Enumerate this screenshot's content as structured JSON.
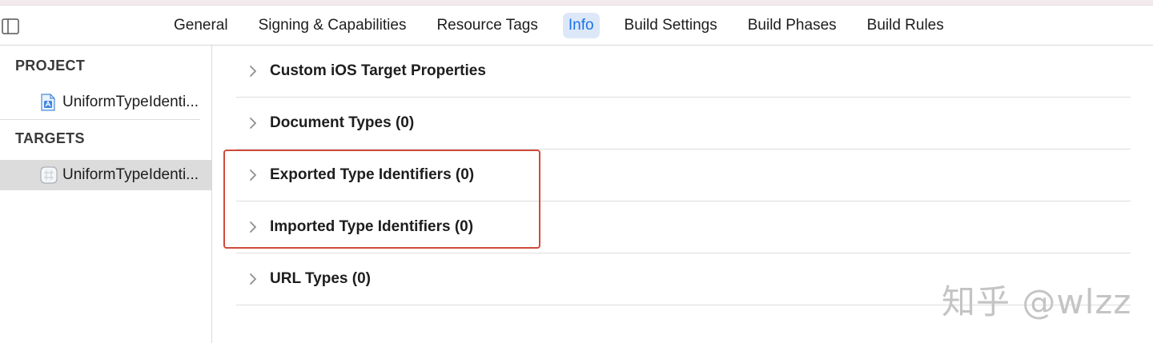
{
  "tabs": [
    {
      "label": "General",
      "active": false
    },
    {
      "label": "Signing & Capabilities",
      "active": false
    },
    {
      "label": "Resource Tags",
      "active": false
    },
    {
      "label": "Info",
      "active": true
    },
    {
      "label": "Build Settings",
      "active": false
    },
    {
      "label": "Build Phases",
      "active": false
    },
    {
      "label": "Build Rules",
      "active": false
    }
  ],
  "sidebar": {
    "project_header": "PROJECT",
    "project_item": {
      "label": "UniformTypeIdenti...",
      "icon": "xcode-project-icon"
    },
    "targets_header": "TARGETS",
    "target_item": {
      "label": "UniformTypeIdenti...",
      "icon": "app-target-icon",
      "selected": true
    }
  },
  "sections": [
    {
      "title": "Custom iOS Target Properties"
    },
    {
      "title": "Document Types (0)"
    },
    {
      "title": "Exported Type Identifiers (0)"
    },
    {
      "title": "Imported Type Identifiers (0)"
    },
    {
      "title": "URL Types (0)"
    }
  ],
  "watermark": "知乎 @wlzz",
  "colors": {
    "accent": "#1a73e8",
    "active_tab_bg": "#dce8f8",
    "highlight_border": "#d04a3c",
    "selected_row": "#dcdcdc"
  }
}
